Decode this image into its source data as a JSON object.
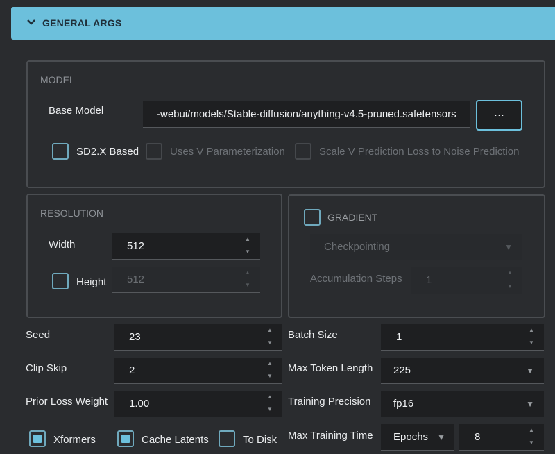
{
  "header": {
    "title": "GENERAL ARGS",
    "icon": "chevron-down-icon"
  },
  "model": {
    "section_title": "MODEL",
    "base_model_label": "Base Model",
    "base_model_value": "-webui/models/Stable-diffusion/anything-v4.5-pruned.safetensors",
    "browse_label": "···",
    "sd2x_label": "SD2.X Based",
    "sd2x_checked": false,
    "v_param_label": "Uses V Parameterization",
    "scale_v_label": "Scale V Prediction Loss to Noise Prediction"
  },
  "resolution": {
    "section_title": "RESOLUTION",
    "width_label": "Width",
    "width_value": "512",
    "height_label": "Height",
    "height_value": "512",
    "height_checked": false
  },
  "gradient": {
    "label": "GRADIENT",
    "checked": false,
    "checkpointing_value": "Checkpointing",
    "accum_label": "Accumulation Steps",
    "accum_value": "1"
  },
  "args": {
    "seed_label": "Seed",
    "seed_value": "23",
    "clip_skip_label": "Clip Skip",
    "clip_skip_value": "2",
    "prior_loss_label": "Prior Loss Weight",
    "prior_loss_value": "1.00",
    "batch_size_label": "Batch Size",
    "batch_size_value": "1",
    "max_token_label": "Max Token Length",
    "max_token_value": "225",
    "precision_label": "Training Precision",
    "precision_value": "fp16",
    "max_time_label": "Max Training Time",
    "max_time_unit": "Epochs",
    "max_time_value": "8"
  },
  "options": {
    "xformers_label": "Xformers",
    "xformers_checked": true,
    "cache_latents_label": "Cache Latents",
    "cache_latents_checked": true,
    "to_disk_label": "To Disk",
    "to_disk_checked": false
  },
  "colors": {
    "accent": "#6cc0dc",
    "background": "#2a2c2f",
    "field": "#1e1f21"
  }
}
